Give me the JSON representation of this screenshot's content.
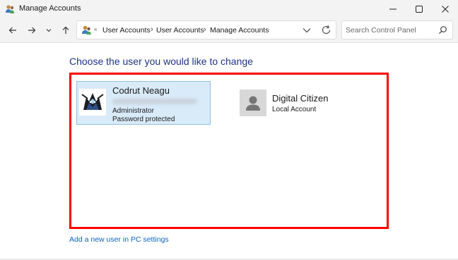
{
  "window": {
    "title": "Manage Accounts",
    "icon": "user-accounts-icon",
    "controls": [
      "minimize-icon",
      "maximize-icon",
      "close-icon"
    ]
  },
  "navigation": {
    "buttons": [
      "back-arrow-icon",
      "forward-arrow-icon",
      "recent-locations-chevron-icon",
      "up-arrow-icon"
    ]
  },
  "address_bar": {
    "icon": "control-panel-user-icon",
    "overflow_marker": "«",
    "breadcrumbs": [
      {
        "label": "User Accounts"
      },
      {
        "label": "User Accounts"
      },
      {
        "label": "Manage Accounts"
      }
    ],
    "separator": "›"
  },
  "search": {
    "placeholder": "Search Control Panel",
    "value": ""
  },
  "main": {
    "title": "Choose the user you would like to change",
    "highlight_color": "#ff0000",
    "users": [
      {
        "name": "Codrut Neagu",
        "email_blurred": true,
        "role": "Administrator",
        "status": "Password protected",
        "avatar": "wolf-avatar-icon",
        "selected": true
      },
      {
        "name": "Digital Citizen",
        "type": "Local Account",
        "avatar": "default-user-avatar-icon",
        "selected": false
      }
    ],
    "add_user_link": "Add a new user in PC settings"
  },
  "colors": {
    "title_blue": "#1e3287",
    "link_blue": "#0b64c0",
    "selected_bg": "#d9ebf9",
    "selected_border": "#92c0e0"
  }
}
